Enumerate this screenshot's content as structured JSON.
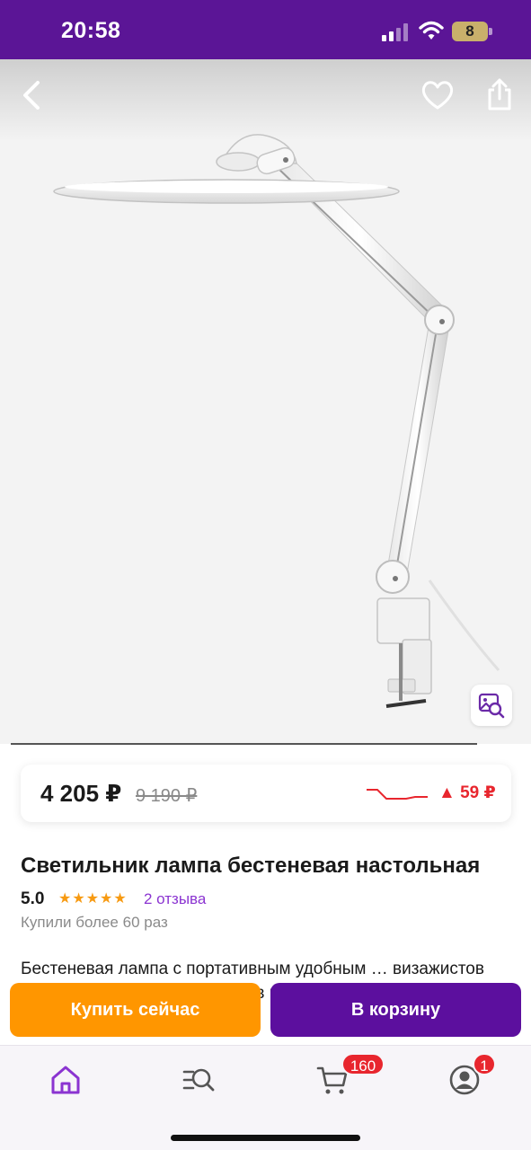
{
  "status_bar": {
    "time": "20:58",
    "battery": "8"
  },
  "product": {
    "price": {
      "current": "4 205 ₽",
      "old": "9 190 ₽",
      "change": "▲ 59 ₽"
    },
    "title": "Светильник лампа бестеневая настольная",
    "rating": "5.0",
    "stars": "★★★★★",
    "reviews": "2 отзыва",
    "bought": "Купили более 60 раз",
    "description": "Бестеневая лампа с портативным удобным … визажистов (мастеров макияжа), мастеров по"
  },
  "actions": {
    "buy_now": "Купить сейчас",
    "add_to_cart": "В корзину"
  },
  "tabbar": {
    "items": [
      {
        "icon": "home-icon",
        "active": true
      },
      {
        "icon": "catalog-search-icon",
        "active": false
      },
      {
        "icon": "cart-icon",
        "active": false,
        "badge": "160"
      },
      {
        "icon": "profile-icon",
        "active": false,
        "badge": "1"
      }
    ]
  },
  "colors": {
    "brand": "#5b1596",
    "accent_orange": "#ff9600",
    "price_up": "#e8262e",
    "link": "#8b34d1"
  }
}
